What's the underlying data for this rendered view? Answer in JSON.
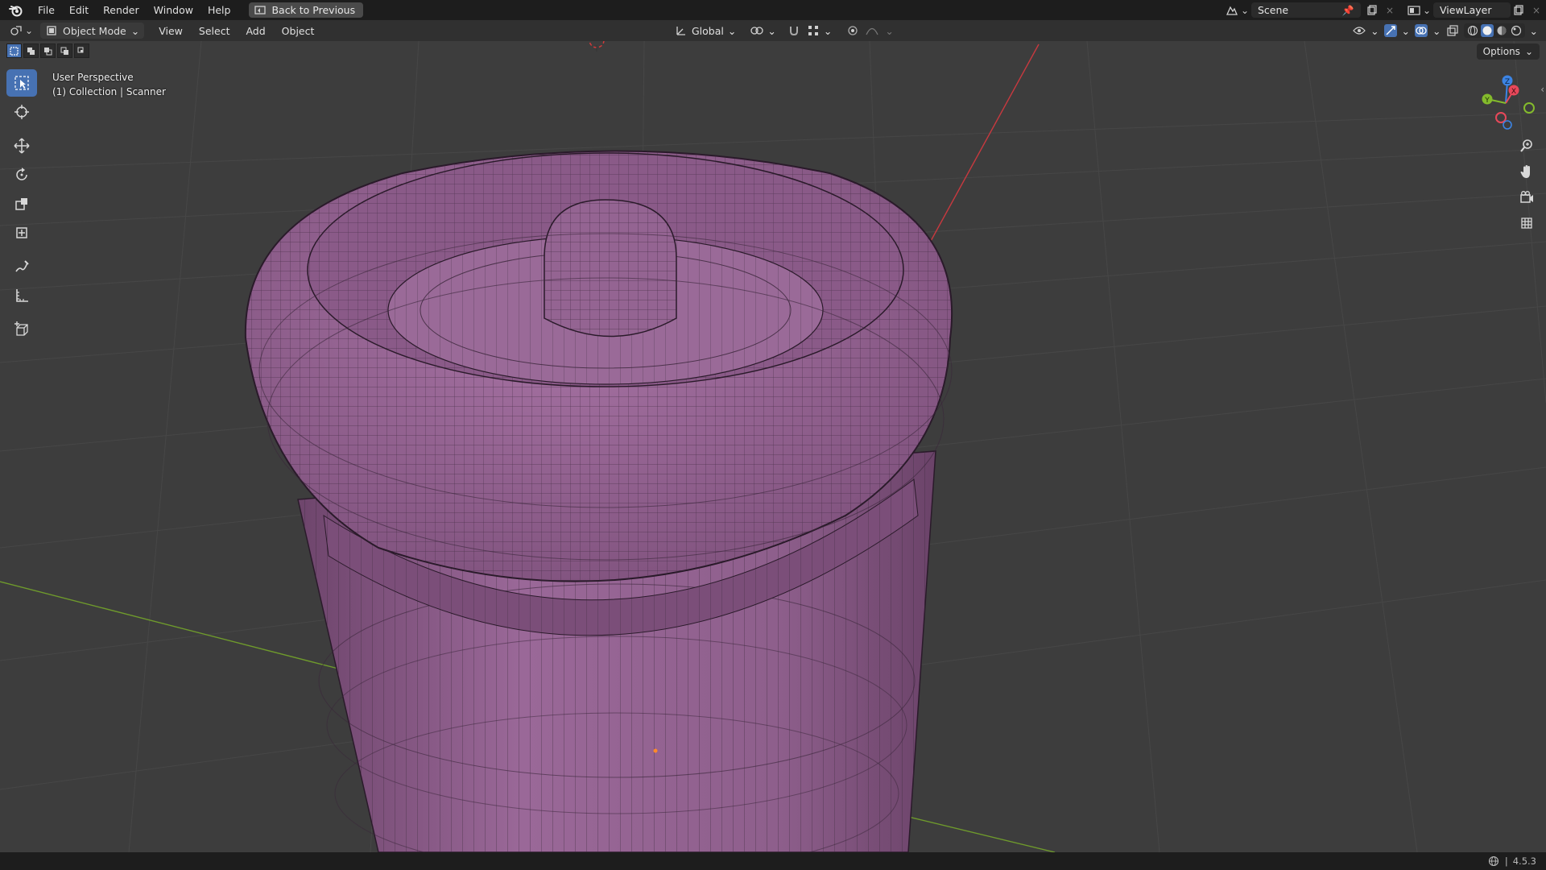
{
  "menu": {
    "items": [
      "File",
      "Edit",
      "Render",
      "Window",
      "Help"
    ],
    "back_button": "Back to Previous"
  },
  "top_right": {
    "scene": "Scene",
    "view_layer": "ViewLayer"
  },
  "header": {
    "mode": "Object Mode",
    "menus": [
      "View",
      "Select",
      "Add",
      "Object"
    ],
    "transform_orientation": "Global",
    "options": "Options"
  },
  "viewport": {
    "perspective": "User Perspective",
    "collection": "(1) Collection | Scanner"
  },
  "gizmo": {
    "x": "X",
    "y": "Y",
    "z": "Z",
    "colors": {
      "x": "#e8485a",
      "y": "#84bb2c",
      "z": "#3c84e4"
    }
  },
  "status": {
    "version": "4.5.3"
  },
  "colors": {
    "accent": "#4772b3",
    "mesh": "#9c6a9a",
    "background": "#3d3d3d"
  }
}
